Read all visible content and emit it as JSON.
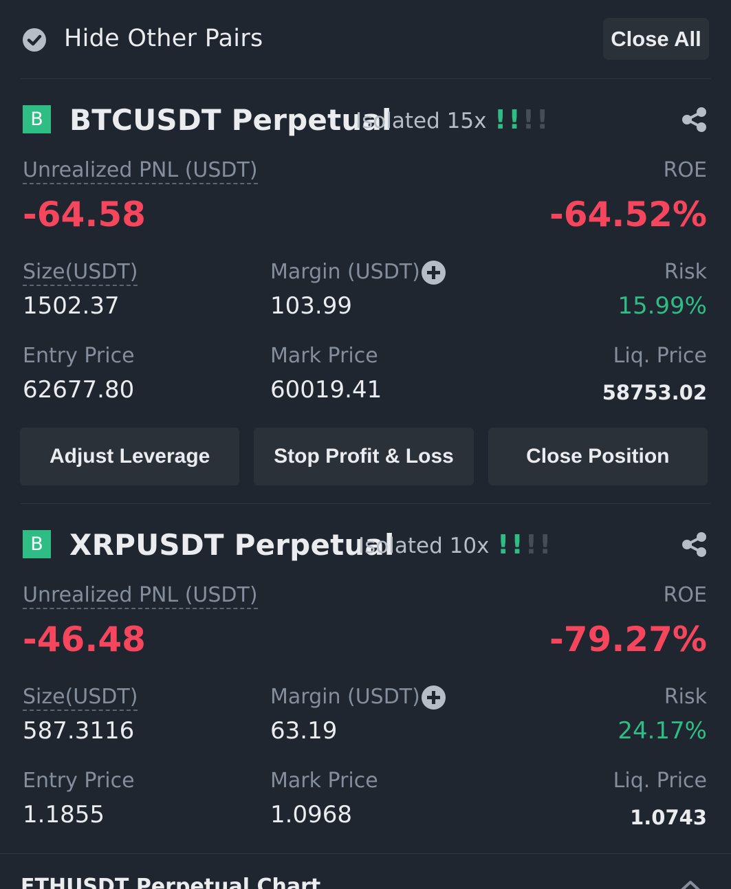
{
  "toolbar": {
    "hide_pairs_label": "Hide Other Pairs",
    "hide_pairs_checked": true,
    "close_all_label": "Close All"
  },
  "positions": [
    {
      "side_badge": "B",
      "symbol": "BTCUSDT Perpetual",
      "margin_mode": "Isolated 15x",
      "risk_bars_active": 2,
      "risk_bars_total": 4,
      "pnl_label": "Unrealized PNL (USDT)",
      "pnl_value": "-64.58",
      "roe_label": "ROE",
      "roe_value": "-64.52%",
      "size_label": "Size(USDT)",
      "size_value": "1502.37",
      "margin_label": "Margin (USDT)",
      "margin_value": "103.99",
      "risk_label": "Risk",
      "risk_value": "15.99%",
      "entry_label": "Entry Price",
      "entry_value": "62677.80",
      "mark_label": "Mark Price",
      "mark_value": "60019.41",
      "liq_label": "Liq. Price",
      "liq_value": "58753.02",
      "adjust_leverage_label": "Adjust Leverage",
      "stop_profit_loss_label": "Stop Profit & Loss",
      "close_position_label": "Close Position"
    },
    {
      "side_badge": "B",
      "symbol": "XRPUSDT Perpetual",
      "margin_mode": "Isolated 10x",
      "risk_bars_active": 2,
      "risk_bars_total": 4,
      "pnl_label": "Unrealized PNL (USDT)",
      "pnl_value": "-46.48",
      "roe_label": "ROE",
      "roe_value": "-79.27%",
      "size_label": "Size(USDT)",
      "size_value": "587.3116",
      "margin_label": "Margin (USDT)",
      "margin_value": "63.19",
      "risk_label": "Risk",
      "risk_value": "24.17%",
      "entry_label": "Entry Price",
      "entry_value": "1.1855",
      "mark_label": "Mark Price",
      "mark_value": "1.0968",
      "liq_label": "Liq. Price",
      "liq_value": "1.0743"
    }
  ],
  "footer": {
    "title": "ETHUSDT Perpetual  Chart"
  },
  "colors": {
    "background": "#1f2630",
    "loss": "#f6465d",
    "profit": "#2ebd85",
    "muted": "#848e9c",
    "button_bg": "#2b3139"
  }
}
